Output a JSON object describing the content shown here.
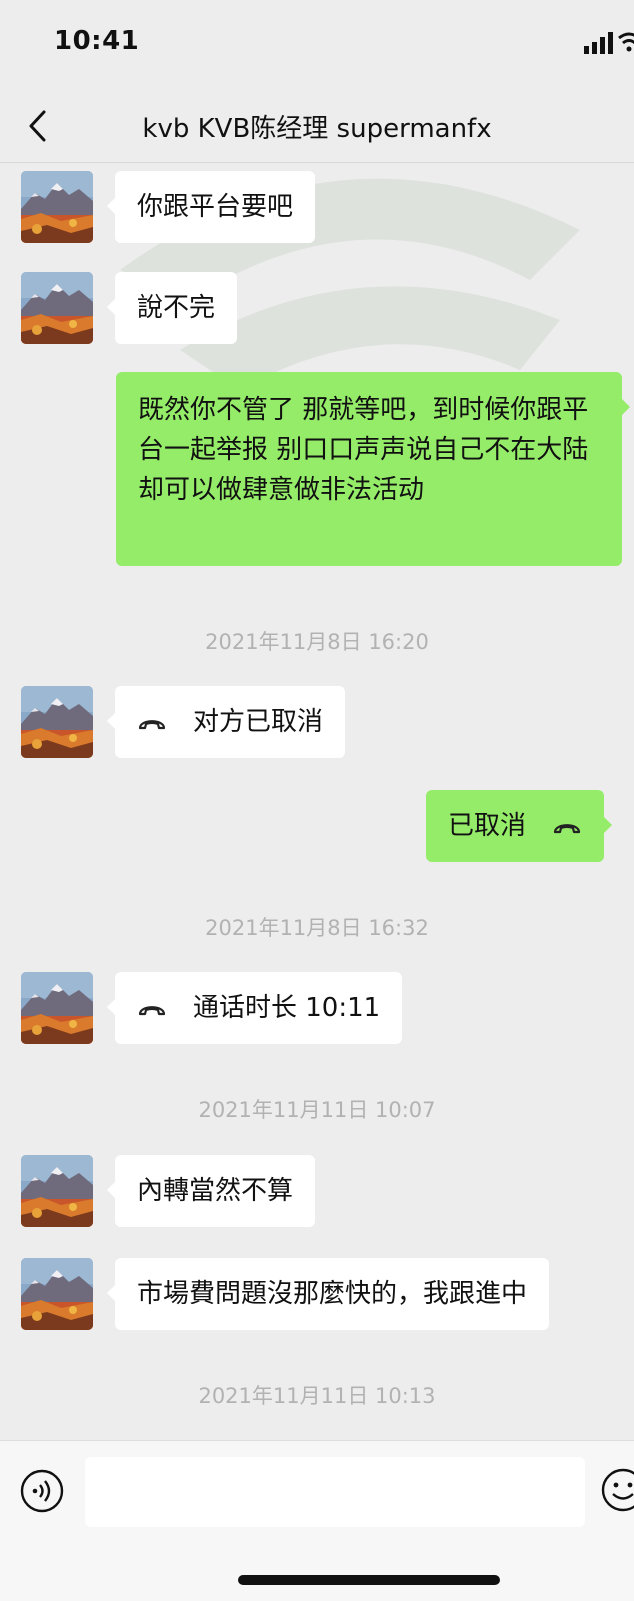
{
  "status": {
    "time": "10:41"
  },
  "nav": {
    "title": "kvb KVB陈经理 supermanfx"
  },
  "messages": {
    "m1": "你跟平台要吧",
    "m2": "說不完",
    "m3": "既然你不管了 那就等吧，到时候你跟平台一起举报 别口口声声说自己不在大陆却可以做肆意做非法活动",
    "t1": "2021年11月8日 16:20",
    "m4": "对方已取消",
    "m5": "已取消",
    "t2": "2021年11月8日 16:32",
    "m6": "通话时长 10:11",
    "t3": "2021年11月11日 10:07",
    "m7": "內轉當然不算",
    "m8": "市場費問題沒那麼快的，我跟進中",
    "t4": "2021年11月11日 10:13"
  },
  "icons": {
    "back": "chevron-left-icon",
    "call": "phone-hangup-icon",
    "voice": "voice-input-icon",
    "emoji": "emoji-icon"
  },
  "colors": {
    "outgoing_bubble": "#95ec69",
    "incoming_bubble": "#ffffff",
    "background": "#ededed",
    "timestamp": "#b2b2b2"
  }
}
